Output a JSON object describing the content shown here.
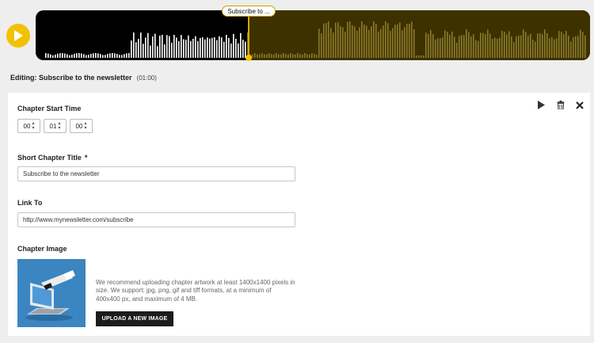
{
  "player": {
    "marker_label": "Subscribe to ...",
    "colors": {
      "accent": "#f2c200",
      "wave_played": "#ffffff",
      "wave_unplayed": "#8a7a2a"
    },
    "progress_fraction": 0.38
  },
  "editing": {
    "prefix": "Editing:",
    "title": "Subscribe to the newsletter",
    "duration": "(01:00)"
  },
  "form": {
    "start_time_label": "Chapter Start Time",
    "start_time": {
      "hours": "00",
      "minutes": "01",
      "seconds": "00"
    },
    "title_label": "Short Chapter Title",
    "required_mark": "*",
    "title_value": "Subscribe to the newsletter",
    "link_label": "Link To",
    "link_value": "http://www.mynewsletter.com/subscribe",
    "image_label": "Chapter Image",
    "image_recommendation": "We recommend uploading chapter artwork at least 1400x1400 pixels in size. We support: jpg, png, gif and tiff formats, at a minimum of 400x400 px, and maximum of 4 MB.",
    "upload_button": "UPLOAD A NEW IMAGE"
  },
  "icons": {
    "play": "play-icon",
    "delete": "trash-icon",
    "close": "close-icon",
    "chevron": "chevron-down-icon"
  }
}
